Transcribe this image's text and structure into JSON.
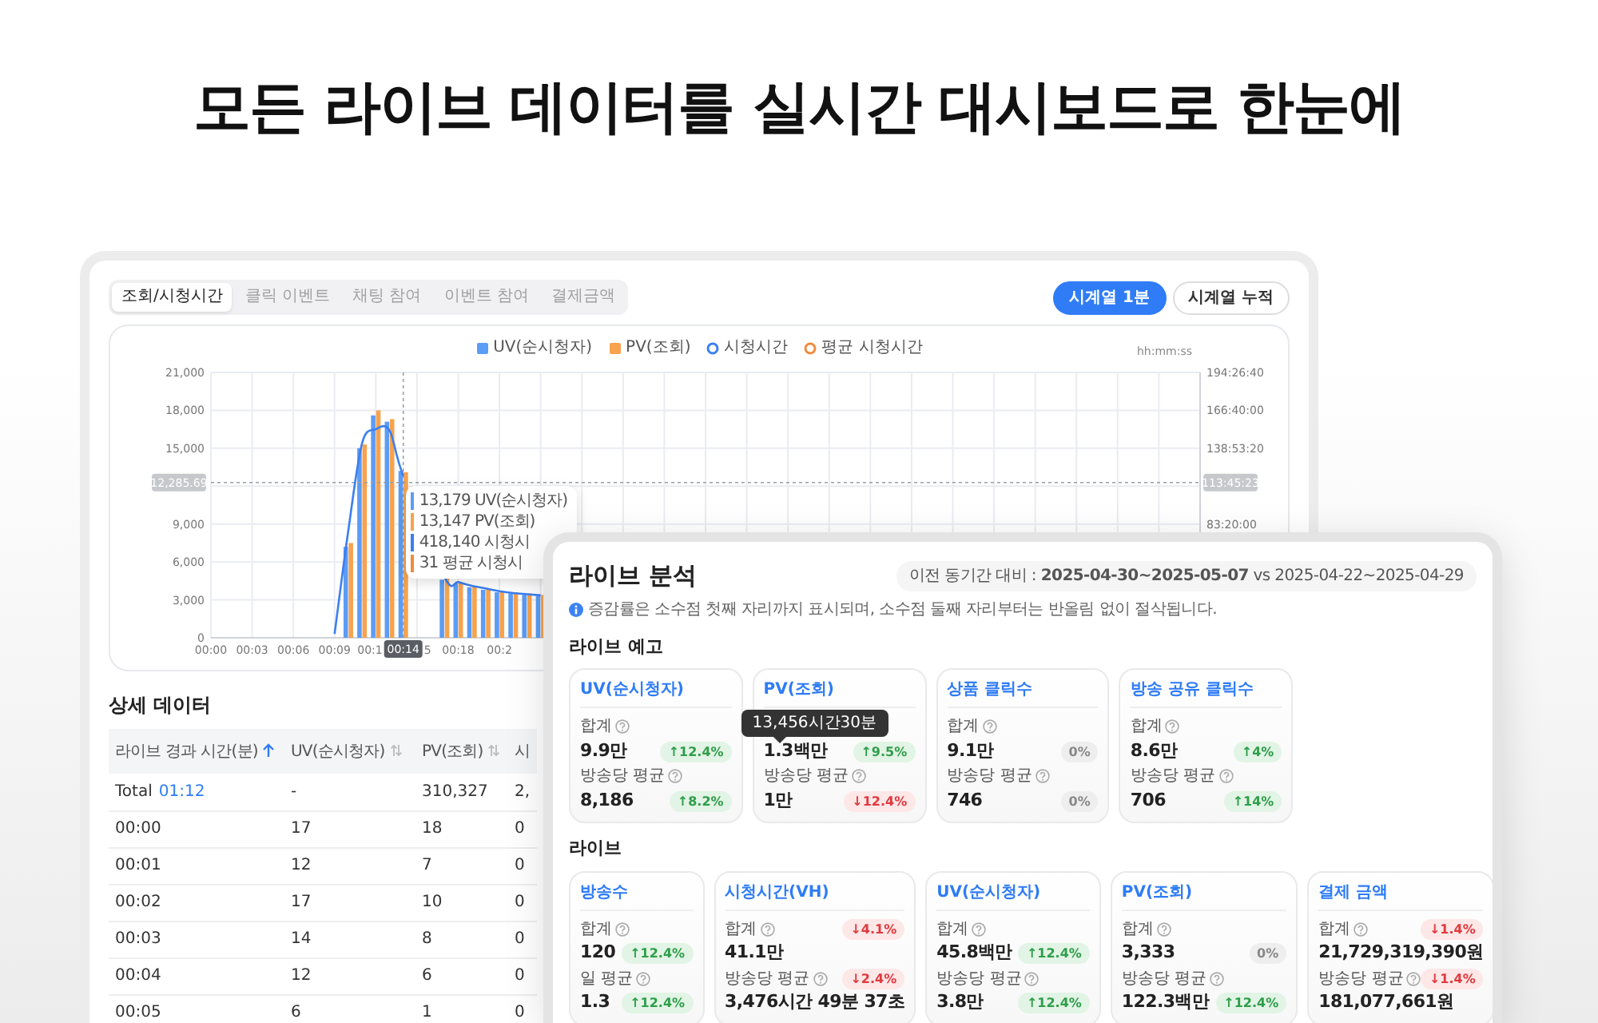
{
  "headline": "모든 라이브 데이터를 실시간 대시보드로 한눈에",
  "back_window": {
    "tabs": [
      {
        "label": "조회/시청시간",
        "selected": true
      },
      {
        "label": "클릭 이벤트",
        "selected": false
      },
      {
        "label": "채팅 참여",
        "selected": false
      },
      {
        "label": "이벤트 참여",
        "selected": false
      },
      {
        "label": "결제금액",
        "selected": false
      }
    ],
    "view_buttons": [
      {
        "label": "시계열 1분",
        "selected": true
      },
      {
        "label": "시계열 누적",
        "selected": false
      }
    ],
    "chart": {
      "extra_legend": [
        {
          "label": "평균 시청시간",
          "kind": "circle",
          "color": "#f28a3c"
        }
      ],
      "unit_label": "hh:mm:ss",
      "cut_tick_labels": [
        "00:1",
        "5"
      ],
      "tooltip": [
        {
          "text": "13,179 UV(순시청자)",
          "color": "#5b9cf5"
        },
        {
          "text": "13,147 PV(조회)",
          "color": "#f7a24e"
        },
        {
          "text": "418,140 시청시",
          "color": "#3b7ff0"
        },
        {
          "text": "31 평균 시청시",
          "color": "#f28a3c"
        }
      ],
      "bars": {
        "chart_data": {
          "type": "bar",
          "x": [
            10,
            11,
            12,
            13,
            14,
            17,
            18,
            19,
            20,
            21,
            22,
            23,
            24
          ],
          "series": [
            {
              "name": "UV(순시청자)",
              "color": "#5b9cf5",
              "values": [
                7200,
                15000,
                17600,
                17100,
                13200,
                4600,
                4300,
                4000,
                3800,
                3600,
                3500,
                3400,
                3300
              ]
            },
            {
              "name": "PV(조회)",
              "color": "#f7a24e",
              "values": [
                7500,
                15300,
                18000,
                17300,
                13100,
                4700,
                4400,
                4100,
                3900,
                3700,
                3600,
                3500,
                3400
              ]
            }
          ],
          "grid": true,
          "xlim": [
            0,
            72
          ],
          "ylim": [
            0,
            21000
          ],
          "xticks": [
            {
              "value": 0,
              "label": "00:00"
            },
            {
              "value": 3,
              "label": "00:03"
            },
            {
              "value": 6,
              "label": "00:06"
            },
            {
              "value": 9,
              "label": "00:09"
            },
            {
              "value": 18,
              "label": "00:18"
            },
            {
              "value": 21,
              "label": "00:2"
            }
          ],
          "yticks": [
            {
              "value": 0,
              "label": "0"
            },
            {
              "value": 3000,
              "label": "3,000"
            },
            {
              "value": 6000,
              "label": "6,000"
            },
            {
              "value": 9000,
              "label": "9,000"
            },
            {
              "value": 15000,
              "label": "15,000"
            },
            {
              "value": 18000,
              "label": "18,000"
            },
            {
              "value": 21000,
              "label": "21,000"
            }
          ],
          "annotations": [
            {
              "x": 14,
              "text": "00:14"
            },
            "12,285.69"
          ]
        }
      },
      "watch_time": {
        "chart_data": {
          "type": "line",
          "x": [
            9,
            10,
            11,
            12,
            13,
            14,
            17,
            18,
            19,
            20,
            21,
            22,
            23,
            24
          ],
          "series": [
            {
              "name": "시청시간",
              "color": "#3b7ff0",
              "values": [
                10000,
                283000,
                513000,
                550000,
                547000,
                427000,
                160000,
                147000,
                137000,
                130000,
                123000,
                118000,
                115000,
                112000
              ]
            }
          ],
          "xlim": [
            0,
            72
          ],
          "ylim": [
            0,
            700000
          ],
          "yticks": [
            {
              "value": 300000,
              "label": "83:20:00"
            },
            {
              "value": 500000,
              "label": "138:53:20"
            },
            {
              "value": 600000,
              "label": "166:40:00"
            },
            {
              "value": 700000,
              "label": "194:26:40"
            }
          ],
          "annotations": [
            "113:45:23"
          ]
        }
      }
    },
    "details_title": "상세 데이터",
    "table": {
      "columns": [
        {
          "label": "라이브 경과 시간(분)",
          "sortable": true,
          "sorted": true
        },
        {
          "label": "UV(순시청자)",
          "sortable": true,
          "sorted": false
        },
        {
          "label": "PV(조회)",
          "sortable": true,
          "sorted": false
        },
        {
          "label": "시",
          "sortable": false
        }
      ],
      "rows": [
        {
          "kind": "total",
          "duration": "01:12",
          "cells": [
            "Total",
            "-",
            "310,327",
            "2,"
          ]
        },
        {
          "kind": "minute",
          "cells": [
            "00:00",
            "17",
            "18",
            "0"
          ]
        },
        {
          "kind": "minute",
          "cells": [
            "00:01",
            "12",
            "7",
            "0"
          ]
        },
        {
          "kind": "minute",
          "cells": [
            "00:02",
            "17",
            "10",
            "0"
          ]
        },
        {
          "kind": "minute",
          "cells": [
            "00:03",
            "14",
            "8",
            "0"
          ]
        },
        {
          "kind": "minute",
          "cells": [
            "00:04",
            "12",
            "6",
            "0"
          ]
        },
        {
          "kind": "minute",
          "cells": [
            "00:05",
            "6",
            "1",
            "0"
          ]
        }
      ]
    }
  },
  "front_window": {
    "title": "라이브 분석",
    "comparison": "이전 동기간 대비 : **2025-04-30~2025-05-07** vs 2025-04-22~2025-04-29",
    "notice": "증감률은 소수점 첫째 자리까지 표시되며, 소수점 둘째 자리부터는 반올림 없이 절삭됩니다.",
    "sections": [
      {
        "title": "라이브 예고",
        "cards": [
          {
            "title": "UV(순시청자)",
            "stats": [
              {
                "label": "합계",
                "value": "9.9만",
                "change": "↑12.4%",
                "kind": "up",
                "badge_on_label": false
              },
              {
                "label": "방송당 평균",
                "value": "8,186",
                "change": "↑8.2%",
                "kind": "up",
                "badge_on_label": false
              }
            ]
          },
          {
            "title": "PV(조회)",
            "stats": [
              {
                "tooltip": "13,456시간30분",
                "value": "1.3백만",
                "change": "↑9.5%",
                "kind": "up",
                "badge_on_label": false
              },
              {
                "label": "방송당 평균",
                "value": "1만",
                "change": "↓12.4%",
                "kind": "down",
                "badge_on_label": false
              }
            ]
          },
          {
            "title": "상품 클릭수",
            "stats": [
              {
                "label": "합계",
                "value": "9.1만",
                "change": "0%",
                "kind": "flat",
                "badge_on_label": false
              },
              {
                "label": "방송당 평균",
                "value": "746",
                "change": "0%",
                "kind": "flat",
                "badge_on_label": false
              }
            ]
          },
          {
            "title": "방송 공유 클릭수",
            "stats": [
              {
                "label": "합계",
                "value": "8.6만",
                "change": "↑4%",
                "kind": "up",
                "badge_on_label": false
              },
              {
                "label": "방송당 평균",
                "value": "706",
                "change": "↑14%",
                "kind": "up",
                "badge_on_label": false
              }
            ]
          }
        ]
      },
      {
        "title": "라이브",
        "cards": [
          {
            "title": "방송수",
            "stats": [
              {
                "label": "합계",
                "value": "120",
                "change": "↑12.4%",
                "kind": "up",
                "badge_on_label": false
              },
              {
                "label": "일 평균",
                "value": "1.3",
                "change": "↑12.4%",
                "kind": "up",
                "badge_on_label": false
              }
            ]
          },
          {
            "title": "시청시간(VH)",
            "stats": [
              {
                "label": "합계",
                "value": "41.1만",
                "change": "↓4.1%",
                "kind": "down",
                "badge_on_label": true
              },
              {
                "label": "방송당 평균",
                "value": "3,476시간 49분 37초",
                "change": "↓2.4%",
                "kind": "down",
                "badge_on_label": true
              }
            ]
          },
          {
            "title": "UV(순시청자)",
            "stats": [
              {
                "label": "합계",
                "value": "45.8백만",
                "change": "↑12.4%",
                "kind": "up",
                "badge_on_label": false
              },
              {
                "label": "방송당 평균",
                "value": "3.8만",
                "change": "↑12.4%",
                "kind": "up",
                "badge_on_label": false
              }
            ]
          },
          {
            "title": "PV(조회)",
            "stats": [
              {
                "label": "합계",
                "value": "3,333",
                "change": "0%",
                "kind": "flat",
                "badge_on_label": false
              },
              {
                "label": "방송당 평균",
                "value": "122.3백만",
                "change": "↑12.4%",
                "kind": "up",
                "badge_on_label": false
              }
            ]
          },
          {
            "title": "결제 금액",
            "stats": [
              {
                "label": "합계",
                "value": "21,729,319,390원",
                "change": "↓1.4%",
                "kind": "down",
                "badge_on_label": true
              },
              {
                "label": "방송당 평균",
                "value": "181,077,661원",
                "change": "↓1.4%",
                "kind": "down",
                "badge_on_label": true
              }
            ]
          }
        ]
      }
    ]
  }
}
